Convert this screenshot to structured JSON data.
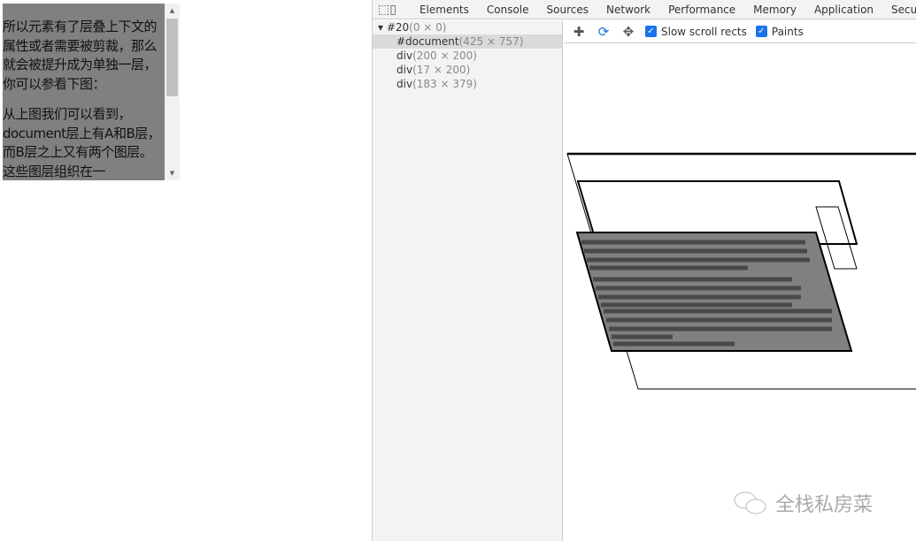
{
  "preview": {
    "paragraphs": [
      "所以元素有了层叠上下文的属性或者需要被剪裁，那么就会被提升成为单独一层，你可以参看下图：",
      "从上图我们可以看到，document层上有A和B层，而B层之上又有两个图层。这些图层组织在一"
    ]
  },
  "devtools": {
    "tabs": [
      "Elements",
      "Console",
      "Sources",
      "Network",
      "Performance",
      "Memory",
      "Application",
      "Secu"
    ],
    "layers": [
      {
        "name": "#20",
        "size": "(0 × 0)"
      },
      {
        "name": "#document",
        "size": "(425 × 757)"
      },
      {
        "name": "div",
        "size": "(200 × 200)"
      },
      {
        "name": "div",
        "size": "(17 × 200)"
      },
      {
        "name": "div",
        "size": "(183 × 379)"
      }
    ],
    "toolbar": {
      "slow_scroll": "Slow scroll rects",
      "paints": "Paints",
      "slow_scroll_checked": true,
      "paints_checked": true
    },
    "accent": "#1a73e8"
  },
  "watermark": "全栈私房菜"
}
